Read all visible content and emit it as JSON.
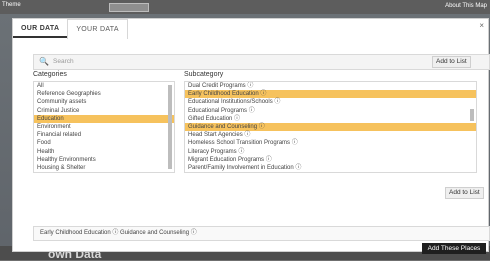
{
  "top_bar": {
    "theme_label": "Theme",
    "about_label": "About This Map"
  },
  "modal": {
    "tabs": [
      {
        "label": "OUR DATA",
        "active": true
      },
      {
        "label": "YOUR DATA",
        "active": false
      }
    ],
    "close_icon": "close-icon",
    "search": {
      "placeholder": "Search",
      "icon": "search-icon"
    },
    "add_to_list_top": "Add to List",
    "categories_label": "Categories",
    "subcategory_label": "Subcategory",
    "categories": [
      {
        "label": "All",
        "selected": false
      },
      {
        "label": "Reference Geographies",
        "selected": false
      },
      {
        "label": "Community assets",
        "selected": false
      },
      {
        "label": "Criminal Justice",
        "selected": false
      },
      {
        "label": "Education",
        "selected": true
      },
      {
        "label": "Environment",
        "selected": false
      },
      {
        "label": "Financial related",
        "selected": false
      },
      {
        "label": "Food",
        "selected": false
      },
      {
        "label": "Health",
        "selected": false
      },
      {
        "label": "Healthy Environments",
        "selected": false
      },
      {
        "label": "Housing & Shelter",
        "selected": false
      }
    ],
    "subcategories": [
      {
        "label": "Dual Credit Programs ⓘ",
        "selected": false
      },
      {
        "label": "Early Childhood Education ⓘ",
        "selected": true
      },
      {
        "label": "Educational Institutions/Schools ⓘ",
        "selected": false
      },
      {
        "label": "Educational Programs ⓘ",
        "selected": false
      },
      {
        "label": "Gifted Education ⓘ",
        "selected": false
      },
      {
        "label": "Guidance and Counseling ⓘ",
        "selected": true
      },
      {
        "label": "Head Start Agencies ⓘ",
        "selected": false
      },
      {
        "label": "Homeless School Transition Programs ⓘ",
        "selected": false
      },
      {
        "label": "Literacy Programs ⓘ",
        "selected": false
      },
      {
        "label": "Migrant Education Programs ⓘ",
        "selected": false
      },
      {
        "label": "Parent/Family Involvement in Education ⓘ",
        "selected": false
      }
    ],
    "add_to_list_bottom": "Add to List",
    "selected_text": "Early Childhood Education ⓘ   Guidance and Counseling ⓘ",
    "add_places_label": "Add These Places"
  },
  "background": {
    "own_data_label": "own Data"
  }
}
